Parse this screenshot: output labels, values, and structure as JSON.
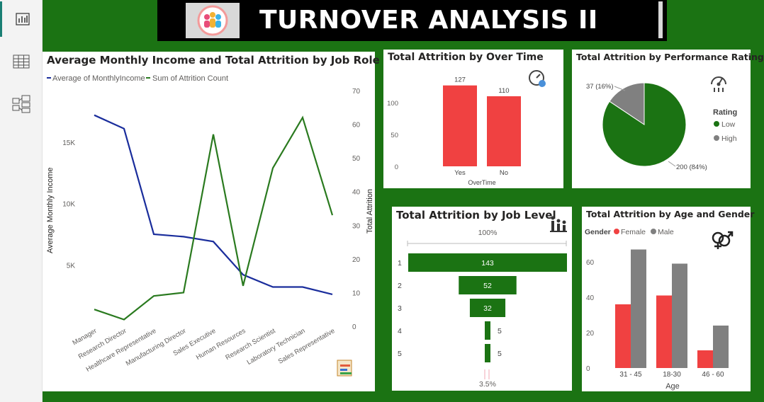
{
  "banner": {
    "title": "TURNOVER ANALYSIS II"
  },
  "sidebar": {
    "items": [
      {
        "name": "report-view-icon",
        "active": true
      },
      {
        "name": "table-view-icon",
        "active": false
      },
      {
        "name": "model-view-icon",
        "active": false
      }
    ]
  },
  "colors": {
    "green": "#1b7313",
    "red": "#f04141",
    "gray": "#808080",
    "navy": "#1a2d9c",
    "line_green": "#2a7a1f"
  },
  "cards": {
    "jobrole": {
      "title": "Average Monthly Income and Total Attrition by Job Role",
      "legend1": "Average of MonthlyIncome",
      "legend2": "Sum of Attrition Count",
      "ylabel_left": "Average Monthly Income",
      "ylabel_right": "Total Attrition",
      "left_ticks": [
        "15K",
        "10K",
        "5K"
      ],
      "right_ticks": [
        "70",
        "60",
        "50",
        "40",
        "30",
        "20",
        "10",
        "0"
      ]
    },
    "overtime": {
      "title": "Total Attrition by Over Time",
      "xlabel": "OverTime",
      "y_ticks": [
        "100",
        "50",
        "0"
      ]
    },
    "performance": {
      "title": "Total Attrition by Performance Rating",
      "legend_title": "Rating",
      "labels": [
        "37 (16%)",
        "200 (84%)"
      ]
    },
    "joblevel": {
      "title": "Total Attrition by Job Level",
      "top_pct": "100%",
      "bottom_pct": "3.5%"
    },
    "agegender": {
      "title": "Total Attrition by Age and Gender",
      "legend_title": "Gender",
      "xlabel": "Age",
      "y_ticks": [
        "60",
        "40",
        "20",
        "0"
      ]
    }
  },
  "chart_data": [
    {
      "type": "line",
      "title": "Average Monthly Income and Total Attrition by Job Role",
      "categories": [
        "Manager",
        "Research Director",
        "Healthcare Representative",
        "Manufacturing Director",
        "Sales Executive",
        "Human Resources",
        "Research Scientist",
        "Laboratory Technician",
        "Sales Representative"
      ],
      "series": [
        {
          "name": "Average of MonthlyIncome",
          "axis": "left",
          "values": [
            17200,
            16100,
            7500,
            7300,
            6900,
            4200,
            3200,
            3200,
            2600
          ]
        },
        {
          "name": "Sum of Attrition Count",
          "axis": "right",
          "values": [
            5,
            2,
            9,
            10,
            57,
            12,
            47,
            62,
            33
          ]
        }
      ],
      "ylabel": "Average Monthly Income",
      "y2label": "Total Attrition",
      "ylim": [
        0,
        19200
      ],
      "y2lim": [
        0,
        70
      ]
    },
    {
      "type": "bar",
      "title": "Total Attrition by Over Time",
      "categories": [
        "Yes",
        "No"
      ],
      "values": [
        127,
        110
      ],
      "xlabel": "OverTime",
      "ylim": [
        0,
        140
      ]
    },
    {
      "type": "pie",
      "title": "Total Attrition by Performance Rating",
      "categories": [
        "Low",
        "High"
      ],
      "values": [
        200,
        37
      ],
      "percents": [
        84,
        16
      ]
    },
    {
      "type": "funnel",
      "title": "Total Attrition by Job Level",
      "categories": [
        "1",
        "2",
        "3",
        "4",
        "5"
      ],
      "values": [
        143,
        52,
        32,
        5,
        5
      ]
    },
    {
      "type": "bar",
      "title": "Total Attrition by Age and Gender",
      "categories": [
        "31 - 45",
        "18-30",
        "46 - 60"
      ],
      "series": [
        {
          "name": "Female",
          "values": [
            36,
            41,
            10
          ]
        },
        {
          "name": "Male",
          "values": [
            67,
            59,
            24
          ]
        }
      ],
      "xlabel": "Age",
      "ylim": [
        0,
        70
      ]
    }
  ]
}
